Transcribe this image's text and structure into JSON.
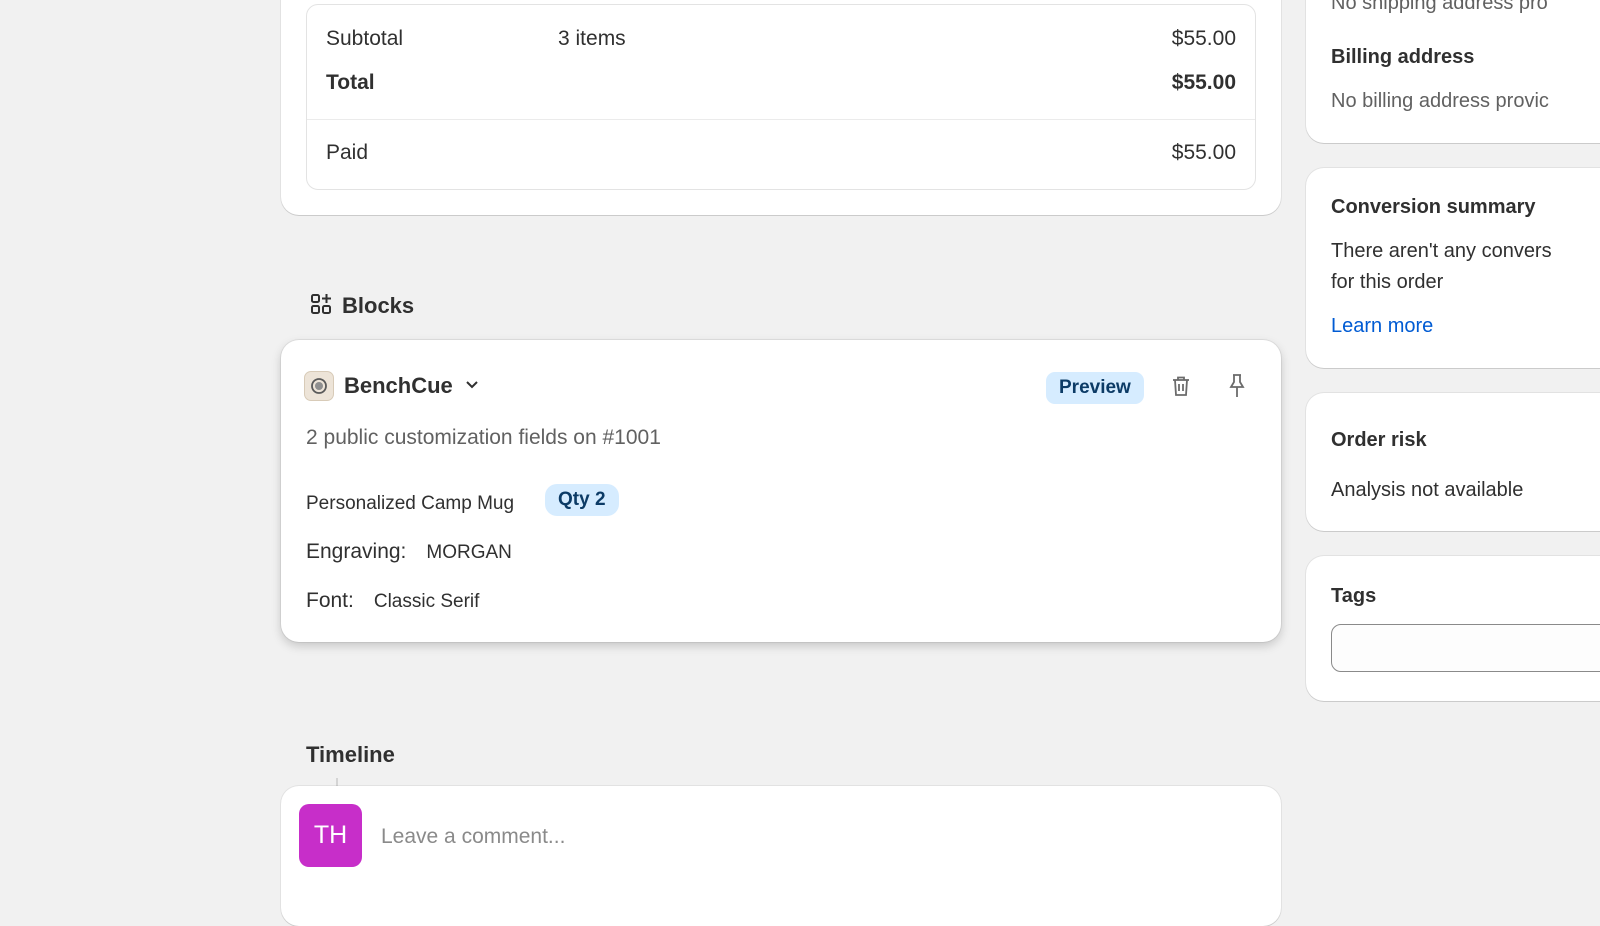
{
  "payment": {
    "subtotal_label": "Subtotal",
    "subtotal_items": "3 items",
    "subtotal_amount": "$55.00",
    "total_label": "Total",
    "total_amount": "$55.00",
    "paid_label": "Paid",
    "paid_amount": "$55.00"
  },
  "blocks": {
    "heading": "Blocks",
    "icon": "blocks-icon"
  },
  "benchcue": {
    "app_name": "BenchCue",
    "badge": "Preview",
    "description": "2 public customization fields on #1001",
    "product_name": "Personalized Camp Mug",
    "qty_badge": "Qty 2",
    "fields": [
      {
        "label": "Engraving:",
        "value": "MORGAN"
      },
      {
        "label": "Font:",
        "value": "Classic Serif"
      }
    ],
    "icons": [
      "app-logo-icon",
      "chevron-down-icon",
      "trash-icon",
      "pin-icon"
    ]
  },
  "timeline": {
    "title": "Timeline",
    "avatar_initials": "TH",
    "avatar_color": "#c72ec9",
    "comment_placeholder": "Leave a comment..."
  },
  "sidebar": {
    "shipping_text": "No shipping address pro",
    "billing_title": "Billing address",
    "billing_text": "No billing address provic",
    "conversion_title": "Conversion summary",
    "conversion_text_1": "There aren't any convers",
    "conversion_text_2": "for this order",
    "learn_more": "Learn more",
    "risk_title": "Order risk",
    "risk_text": "Analysis not available",
    "tags_title": "Tags"
  },
  "colors": {
    "background": "#f1f1f1",
    "link": "#005bd3",
    "badge_bg": "#d6ecff",
    "badge_text": "#0c3b66"
  }
}
